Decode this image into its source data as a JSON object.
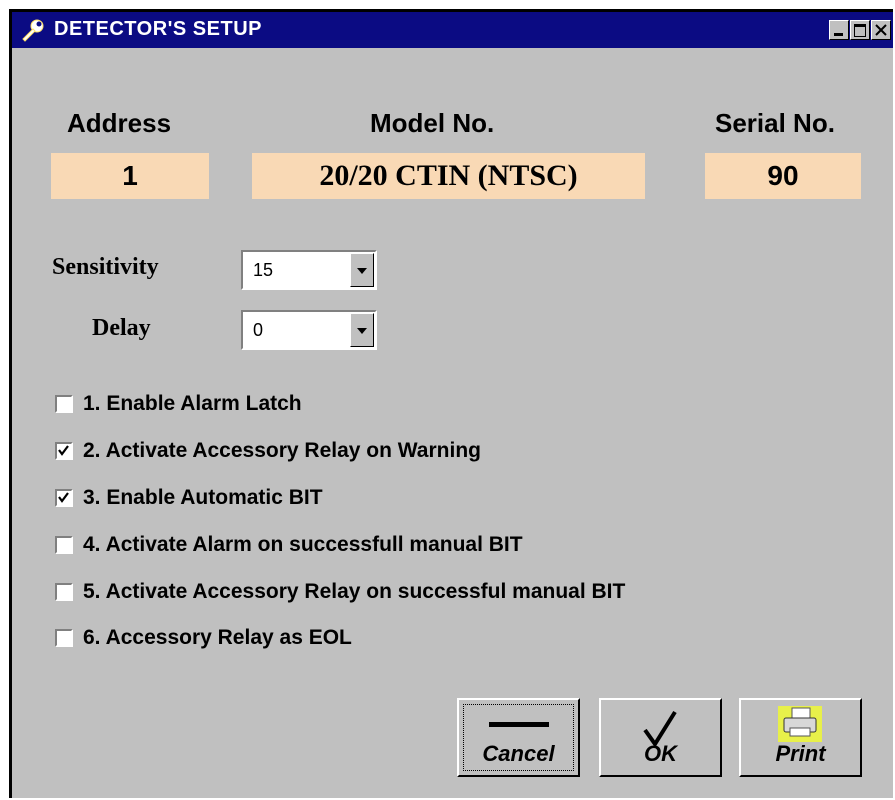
{
  "window": {
    "title": "DETECTOR'S SETUP",
    "title_icon": "wrench-icon"
  },
  "info": {
    "address_label": "Address",
    "address_value": "1",
    "model_label": "Model No.",
    "model_value": "20/20 CTIN (NTSC)",
    "serial_label": "Serial No.",
    "serial_value": "90"
  },
  "fields": {
    "sensitivity_label": "Sensitivity",
    "sensitivity_value": "15",
    "delay_label": "Delay",
    "delay_value": "0"
  },
  "options": [
    {
      "label": "1. Enable Alarm Latch",
      "checked": false
    },
    {
      "label": "2. Activate Accessory Relay on Warning",
      "checked": true
    },
    {
      "label": "3. Enable Automatic BIT",
      "checked": true
    },
    {
      "label": "4. Activate Alarm on successfull manual BIT",
      "checked": false
    },
    {
      "label": "5. Activate Accessory Relay on successful manual BIT",
      "checked": false
    },
    {
      "label": "6. Accessory Relay as EOL",
      "checked": false
    }
  ],
  "buttons": {
    "cancel_label": "Cancel",
    "ok_label": "OK",
    "print_label": "Print"
  },
  "colors": {
    "titlebar": "#0b0b83",
    "value_box": "#f9d9b5",
    "face": "#c0c0c0"
  }
}
